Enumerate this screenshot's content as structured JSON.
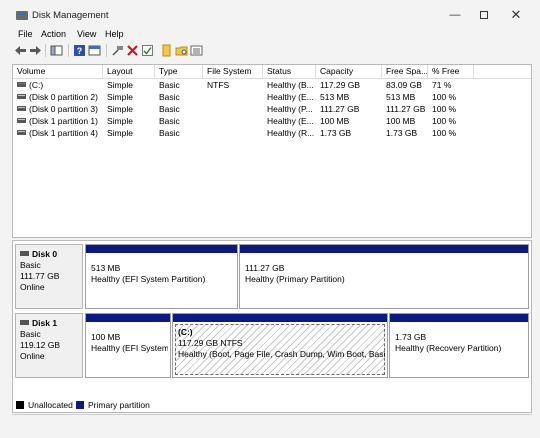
{
  "window": {
    "title": "Disk Management"
  },
  "window_controls": {
    "minimize": "—",
    "close": "✕"
  },
  "menu": [
    "File",
    "Action",
    "View",
    "Help"
  ],
  "toolbar": {
    "icons": [
      "back-arrow-icon",
      "forward-arrow-icon",
      "console-tree-icon",
      "help-icon",
      "properties-icon",
      "connect-icon",
      "delete-icon",
      "check-icon",
      "open-folder-icon",
      "explore-folder-icon",
      "list-view-icon"
    ]
  },
  "volume_list": {
    "columns": [
      "Volume",
      "Layout",
      "Type",
      "File System",
      "Status",
      "Capacity",
      "Free Spa...",
      "% Free"
    ],
    "rows": [
      {
        "volume": "(C:)",
        "layout": "Simple",
        "type": "Basic",
        "fs": "NTFS",
        "status": "Healthy (B...",
        "capacity": "117.29 GB",
        "free": "83.09 GB",
        "pct": "71 %"
      },
      {
        "volume": "(Disk 0 partition 2)",
        "layout": "Simple",
        "type": "Basic",
        "fs": "",
        "status": "Healthy (E...",
        "capacity": "513 MB",
        "free": "513 MB",
        "pct": "100 %"
      },
      {
        "volume": "(Disk 0 partition 3)",
        "layout": "Simple",
        "type": "Basic",
        "fs": "",
        "status": "Healthy (P...",
        "capacity": "111.27 GB",
        "free": "111.27 GB",
        "pct": "100 %"
      },
      {
        "volume": "(Disk 1 partition 1)",
        "layout": "Simple",
        "type": "Basic",
        "fs": "",
        "status": "Healthy (E...",
        "capacity": "100 MB",
        "free": "100 MB",
        "pct": "100 %"
      },
      {
        "volume": "(Disk 1 partition 4)",
        "layout": "Simple",
        "type": "Basic",
        "fs": "",
        "status": "Healthy (R...",
        "capacity": "1.73 GB",
        "free": "1.73 GB",
        "pct": "100 %"
      }
    ]
  },
  "disks": [
    {
      "name": "Disk 0",
      "type": "Basic",
      "size": "111.77 GB",
      "state": "Online",
      "partitions": [
        {
          "title": "",
          "size": "513 MB",
          "status": "Healthy (EFI System Partition)"
        },
        {
          "title": "",
          "size": "111.27 GB",
          "status": "Healthy (Primary Partition)"
        }
      ]
    },
    {
      "name": "Disk 1",
      "type": "Basic",
      "size": "119.12 GB",
      "state": "Online",
      "partitions": [
        {
          "title": "",
          "size": "100 MB",
          "status": "Healthy (EFI System"
        },
        {
          "title": "(C:)",
          "size": "117.29 GB NTFS",
          "status": "Healthy (Boot, Page File, Crash Dump, Wim Boot, Basic D"
        },
        {
          "title": "",
          "size": "1.73 GB",
          "status": "Healthy (Recovery Partition)"
        }
      ]
    }
  ],
  "legend": [
    {
      "label": "Unallocated",
      "color": "#000000"
    },
    {
      "label": "Primary partition",
      "color": "#0a1a80"
    }
  ]
}
